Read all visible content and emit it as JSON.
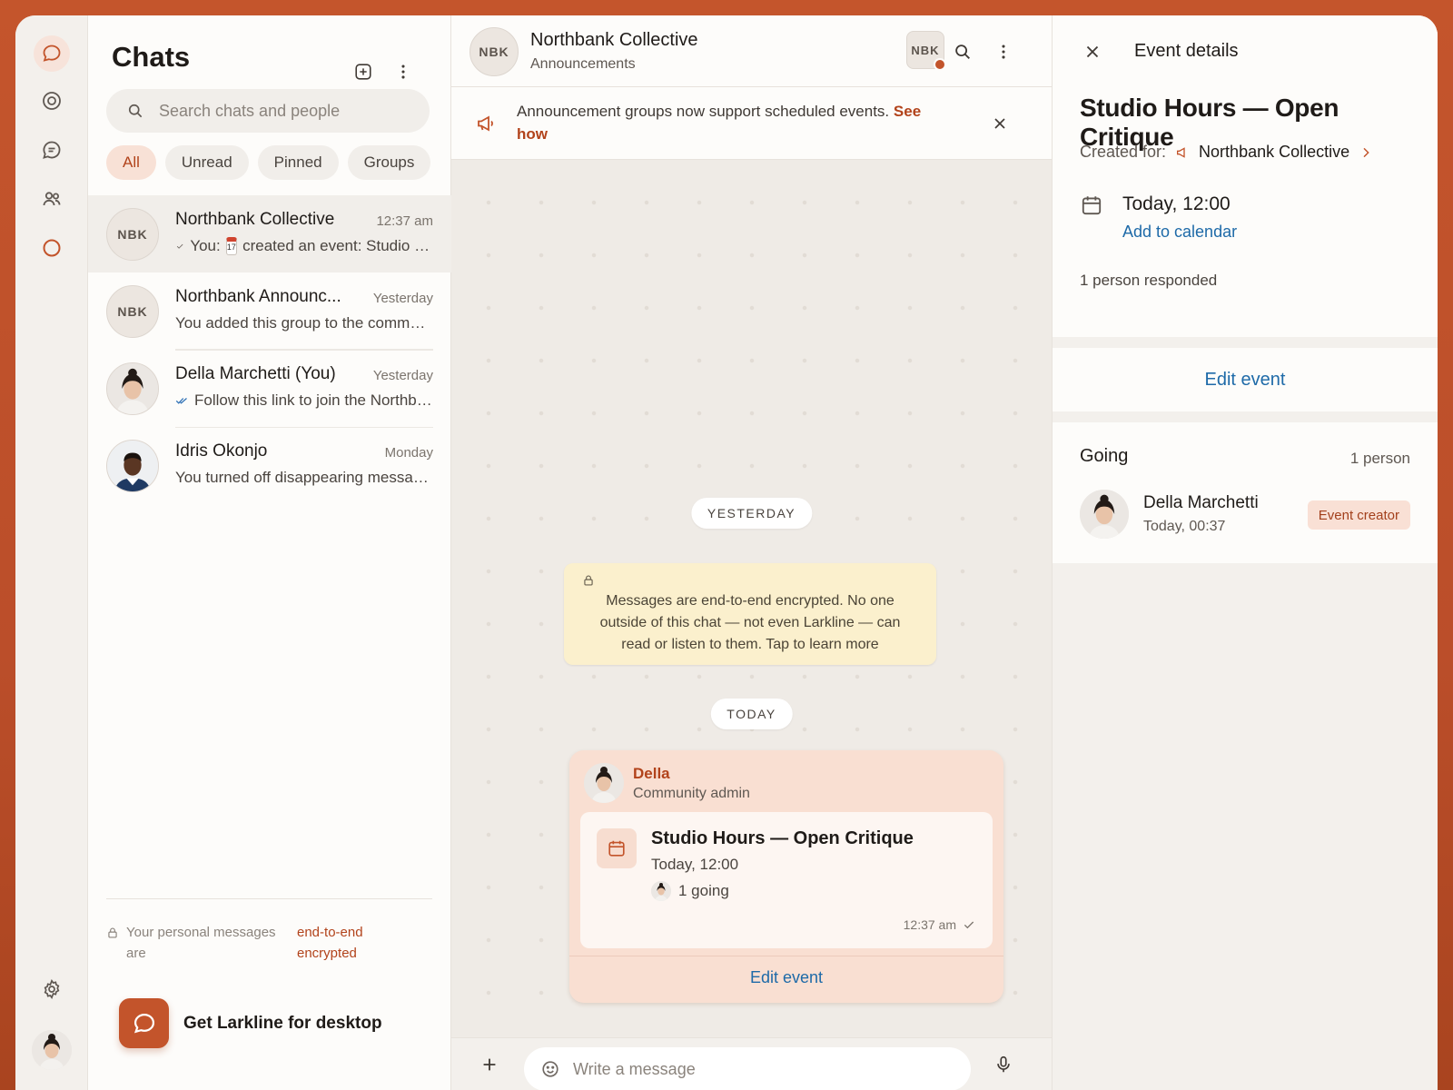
{
  "app": {
    "name": "Larkline"
  },
  "sidebar_list": {
    "title": "Chats",
    "search_placeholder": "Search chats and people",
    "filters": [
      "All",
      "Unread",
      "Pinned",
      "Groups"
    ],
    "chats": [
      {
        "avatar": "NBK",
        "name": "Northbank Collective",
        "time": "12:37 am",
        "preview_prefix": "You:",
        "preview": "created an event: Studio Hours — Open Critique",
        "has_emoji": true
      },
      {
        "avatar": "NBK",
        "name": "Northbank Announc...",
        "time": "Yesterday",
        "preview_prefix": "",
        "preview": "You added this group to the community"
      },
      {
        "avatar": "",
        "name": "Della Marchetti (You)",
        "time": "Yesterday",
        "preview_prefix": "",
        "preview": "Follow this link to join the Northbank Collective"
      },
      {
        "avatar": "",
        "name": "Idris Okonjo",
        "time": "Monday",
        "preview_prefix": "",
        "preview": "You turned off disappearing messages"
      }
    ],
    "e2e_text": "Your personal messages are",
    "e2e_link": "end-to-end encrypted",
    "desktop_promo": "Get Larkline for desktop"
  },
  "chat": {
    "avatar": "NBK",
    "title": "Northbank Collective",
    "subtitle": "Announcements",
    "header_badge": "NBK",
    "banner_text": "Announcement groups now support scheduled events.",
    "banner_link": "See how",
    "day_yesterday": "YESTERDAY",
    "encryption_notice": "Messages are end-to-end encrypted. No one outside of this chat — not even Larkline — can read or listen to them. Tap to learn more",
    "day_today": "TODAY",
    "event_message": {
      "sender": "Della",
      "role": "Community admin",
      "event_title": "Studio Hours — Open Critique",
      "event_date": "Today, 12:00",
      "going": "1 going",
      "time": "12:37 am",
      "edit_label": "Edit event"
    },
    "composer_placeholder": "Write a message"
  },
  "details": {
    "header": "Event details",
    "event_title": "Studio Hours — Open Critique",
    "created_for_label": "Created for:",
    "created_for_group": "Northbank Collective",
    "date": "Today, 12:00",
    "add_to_calendar": "Add to calendar",
    "responded": "1 person responded",
    "edit_label": "Edit event",
    "going_label": "Going",
    "going_count": "1 person",
    "attendee": {
      "name": "Della Marchetti",
      "time": "Today, 00:37",
      "tag": "Event creator"
    }
  },
  "colors": {
    "accent": "#c3542b",
    "link": "#1e6aa8",
    "notice": "#fbf0cd"
  }
}
